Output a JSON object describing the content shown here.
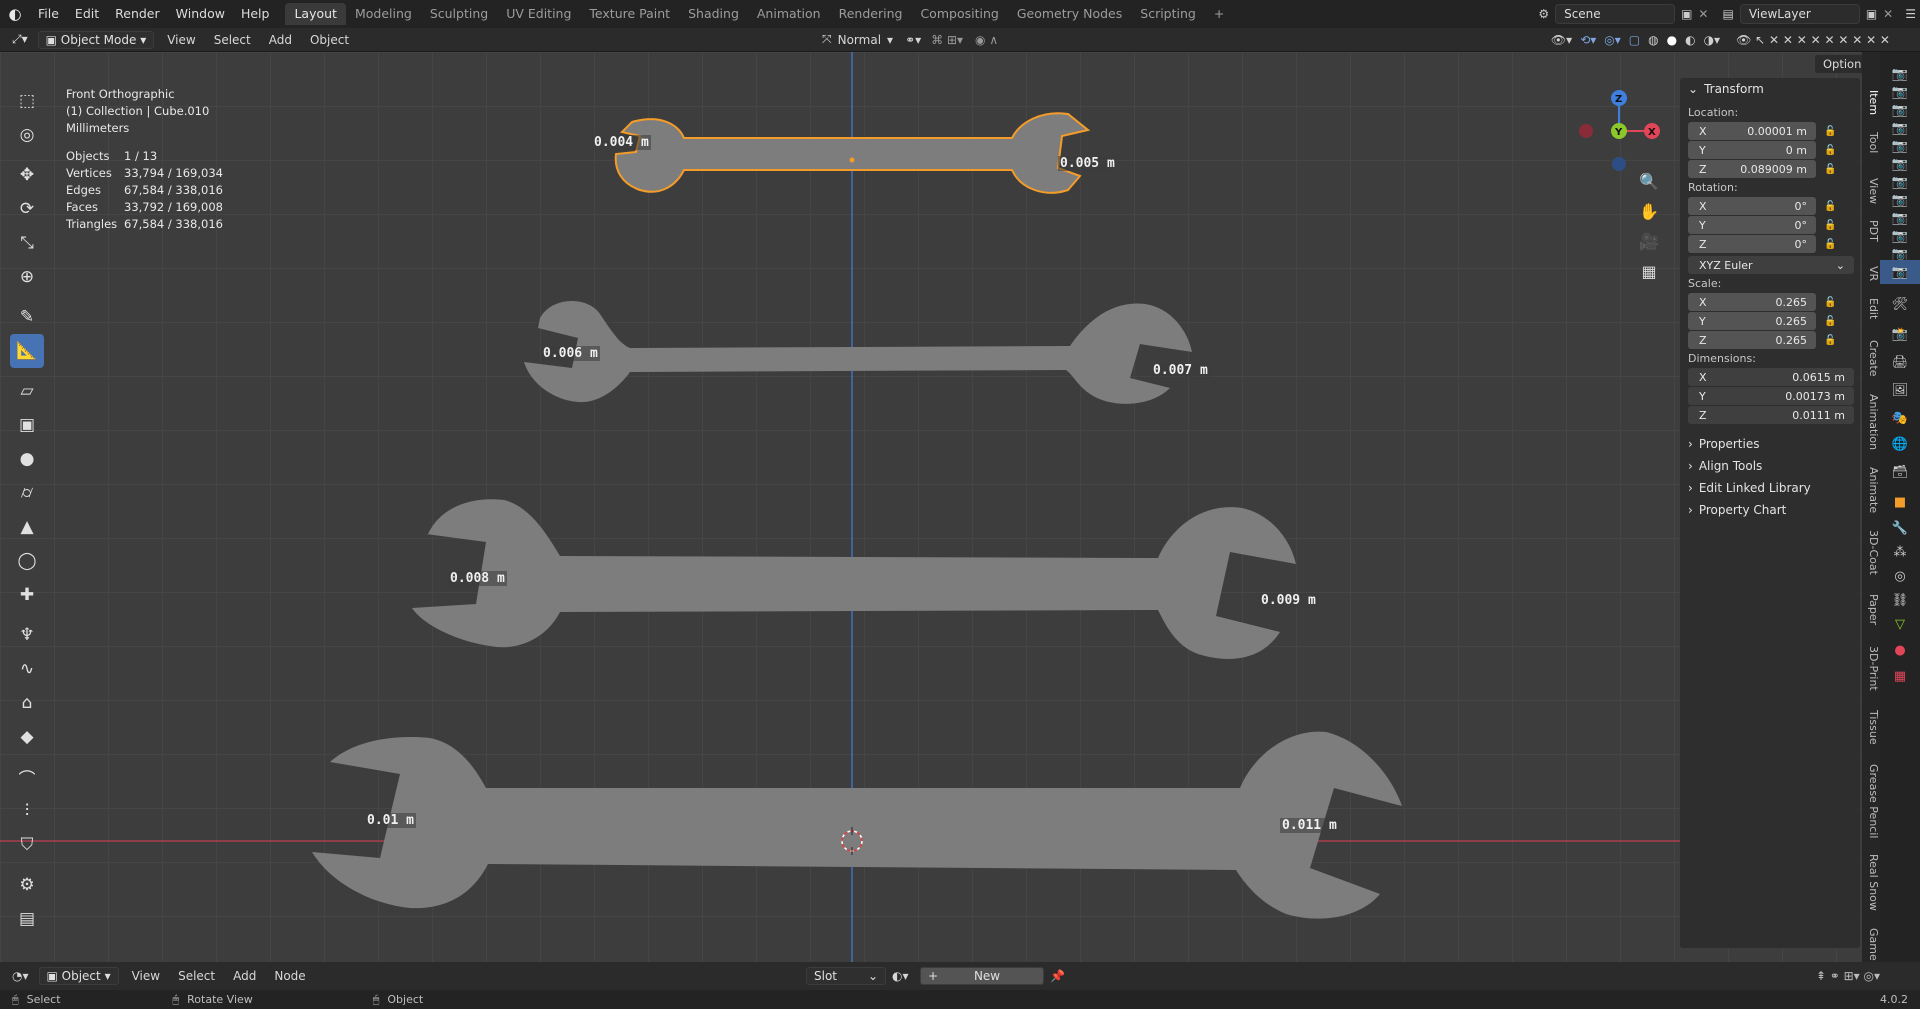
{
  "menu": [
    "File",
    "Edit",
    "Render",
    "Window",
    "Help"
  ],
  "workspaces": [
    "Layout",
    "Modeling",
    "Sculpting",
    "UV Editing",
    "Texture Paint",
    "Shading",
    "Animation",
    "Rendering",
    "Compositing",
    "Geometry Nodes",
    "Scripting"
  ],
  "active_workspace": "Layout",
  "scene": "Scene",
  "view_layer": "ViewLayer",
  "header": {
    "mode": "Object Mode",
    "menus": [
      "View",
      "Select",
      "Add",
      "Object"
    ],
    "transform_orientation": "Normal",
    "options_label": "Options"
  },
  "viewport": {
    "view_name": "Front Orthographic",
    "collection": "(1) Collection | Cube.010",
    "units": "Millimeters",
    "stats": [
      {
        "k": "Objects",
        "v": "1 / 13"
      },
      {
        "k": "Vertices",
        "v": "33,794 / 169,034"
      },
      {
        "k": "Edges",
        "v": "67,584 / 338,016"
      },
      {
        "k": "Faces",
        "v": "33,792 / 169,008"
      },
      {
        "k": "Triangles",
        "v": "67,584 / 338,016"
      }
    ],
    "dimension_labels": [
      "0.004 m",
      "0.005 m",
      "0.006 m",
      "0.007 m",
      "0.008 m",
      "0.009 m",
      "0.01 m",
      "0.011 m"
    ],
    "gizmo_axes": {
      "z": "Z",
      "y": "Y",
      "x": "X"
    }
  },
  "npanel": {
    "transform_title": "Transform",
    "location_label": "Location:",
    "location": [
      {
        "axis": "X",
        "value": "0.00001 m"
      },
      {
        "axis": "Y",
        "value": "0 m"
      },
      {
        "axis": "Z",
        "value": "0.089009 m"
      }
    ],
    "rotation_label": "Rotation:",
    "rotation": [
      {
        "axis": "X",
        "value": "0°"
      },
      {
        "axis": "Y",
        "value": "0°"
      },
      {
        "axis": "Z",
        "value": "0°"
      }
    ],
    "rotation_mode": "XYZ Euler",
    "scale_label": "Scale:",
    "scale": [
      {
        "axis": "X",
        "value": "0.265"
      },
      {
        "axis": "Y",
        "value": "0.265"
      },
      {
        "axis": "Z",
        "value": "0.265"
      }
    ],
    "dimensions_label": "Dimensions:",
    "dimensions": [
      {
        "axis": "X",
        "value": "0.0615 m"
      },
      {
        "axis": "Y",
        "value": "0.00173 m"
      },
      {
        "axis": "Z",
        "value": "0.0111 m"
      }
    ],
    "collapsed_sections": [
      "Properties",
      "Align Tools",
      "Edit Linked Library",
      "Property Chart"
    ]
  },
  "side_tabs": [
    "Item",
    "Tool",
    "View",
    "PDT",
    "VR",
    "Edit",
    "Create",
    "Animation",
    "Animate",
    "3D-Coat",
    "Paper",
    "3D-Print",
    "Tissue",
    "Grease Pencil",
    "Real Snow",
    "Game"
  ],
  "bottom_header": {
    "mode": "Object",
    "menus": [
      "View",
      "Select",
      "Add",
      "Node"
    ],
    "slot": "Slot",
    "new_label": "New"
  },
  "statusbar": {
    "items": [
      "Select",
      "Rotate View",
      "Object"
    ],
    "version": "4.0.2"
  },
  "colors": {
    "selection": "#f39c29",
    "axis_x": "#e24458",
    "axis_y": "#8cc82c",
    "axis_z": "#3f7fe0",
    "wrench": "#7c7c7c"
  }
}
